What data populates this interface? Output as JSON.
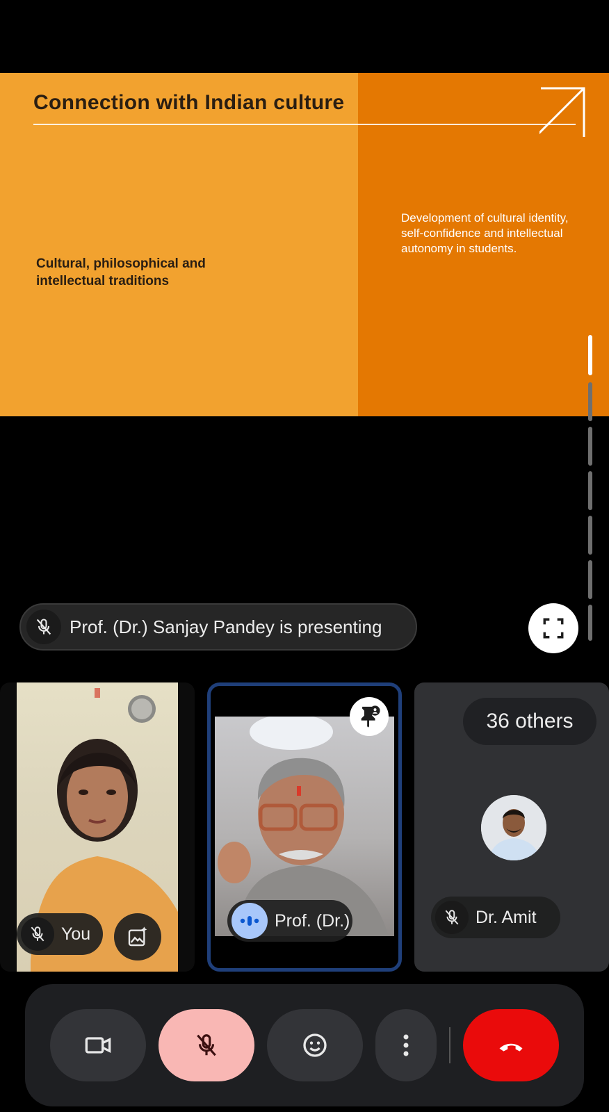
{
  "slide": {
    "title": "Connection with Indian culture",
    "left_text": "Cultural, philosophical and intellectual traditions",
    "right_text": "Development of cultural identity, self-confidence and intellectual autonomy in students."
  },
  "presenting": {
    "label": "Prof. (Dr.) Sanjay Pandey is presenting"
  },
  "tiles": {
    "self": {
      "name": "You"
    },
    "pinned": {
      "name": "Prof. (Dr.)"
    },
    "others": {
      "count_label": "36 others",
      "name": "Dr. Amit"
    }
  },
  "colors": {
    "slide_left": "#f2a22f",
    "slide_right": "#e47802",
    "mic_muted_bg": "#f9b7b4",
    "end_call": "#ea0b0b",
    "pinned_border": "#1f3f7a",
    "speaking": "#a8c7fa"
  },
  "icons": {
    "presenting_mic": "mic-off-icon",
    "fullscreen": "fullscreen-icon",
    "pin": "pin-icon",
    "effects": "image-effects-icon",
    "camera": "video-camera-icon",
    "mic": "mic-off-icon",
    "reactions": "emoji-icon",
    "more": "more-vertical-icon",
    "end": "phone-hangup-icon"
  }
}
